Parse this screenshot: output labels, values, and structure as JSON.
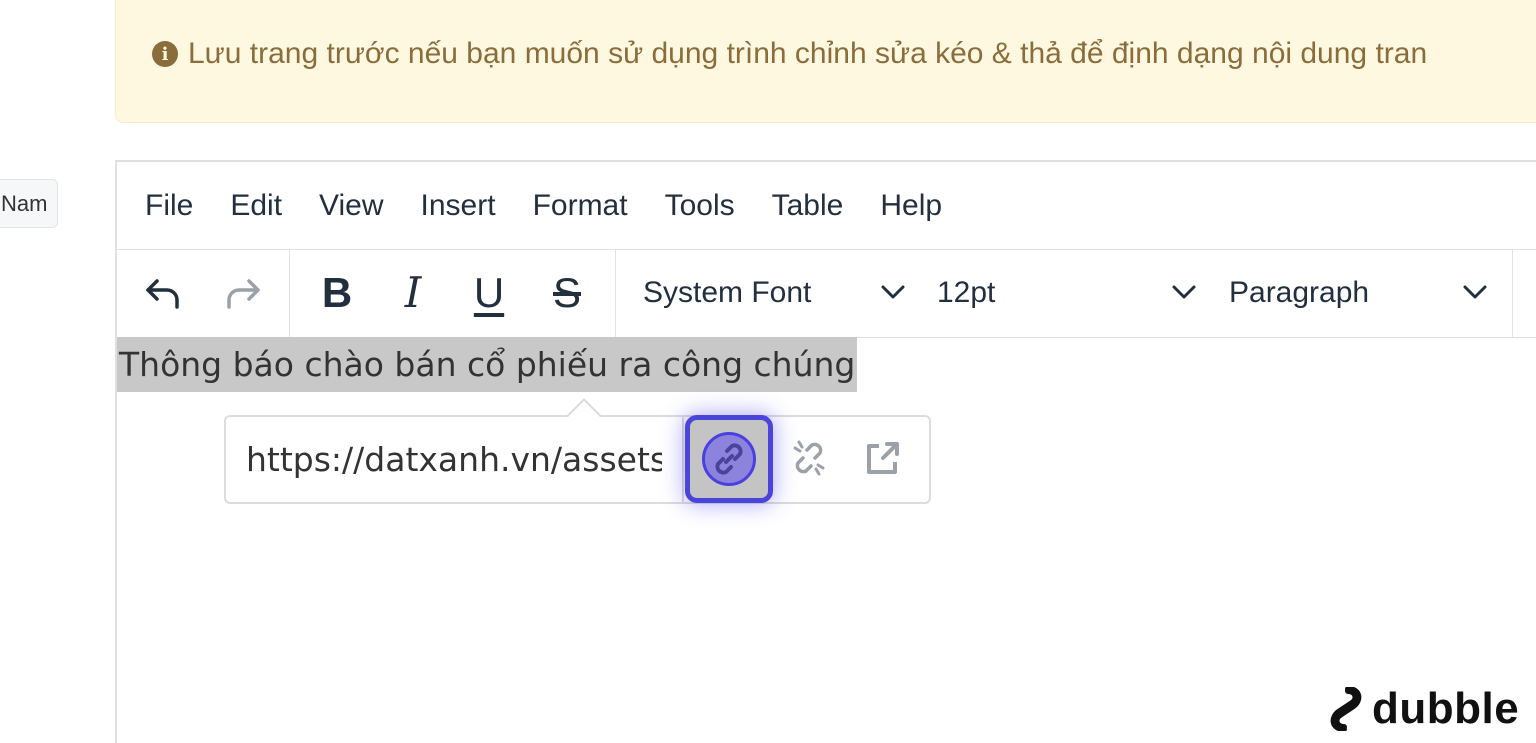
{
  "side_pill": {
    "label": "Nam"
  },
  "notice": {
    "icon": "info-icon",
    "text": "Lưu trang trước nếu bạn muốn sử dụng trình chỉnh sửa kéo & thả để định dạng nội dung tran"
  },
  "menubar": {
    "items": [
      "File",
      "Edit",
      "View",
      "Insert",
      "Format",
      "Tools",
      "Table",
      "Help"
    ]
  },
  "toolbar": {
    "undo_icon": "undo-icon",
    "redo_icon": "redo-icon",
    "bold": "B",
    "italic": "I",
    "underline": "U",
    "strikethrough": "S",
    "font_family": "System Font",
    "font_size": "12pt",
    "block_format": "Paragraph"
  },
  "content": {
    "text": "Thông báo chào bán cổ phiếu ra công chúng"
  },
  "link_popup": {
    "url_value": "https://datxanh.vn/assets/uploads/",
    "link_icon": "link-icon",
    "unlink_icon": "unlink-icon",
    "open_icon": "open-external-icon"
  },
  "watermark": {
    "text": "dubble"
  },
  "colors": {
    "notice_bg": "#fff8e1",
    "notice_text": "#8a6d3b",
    "selection_bg": "#c8c8c8",
    "focus_ring": "#4a44d8"
  }
}
